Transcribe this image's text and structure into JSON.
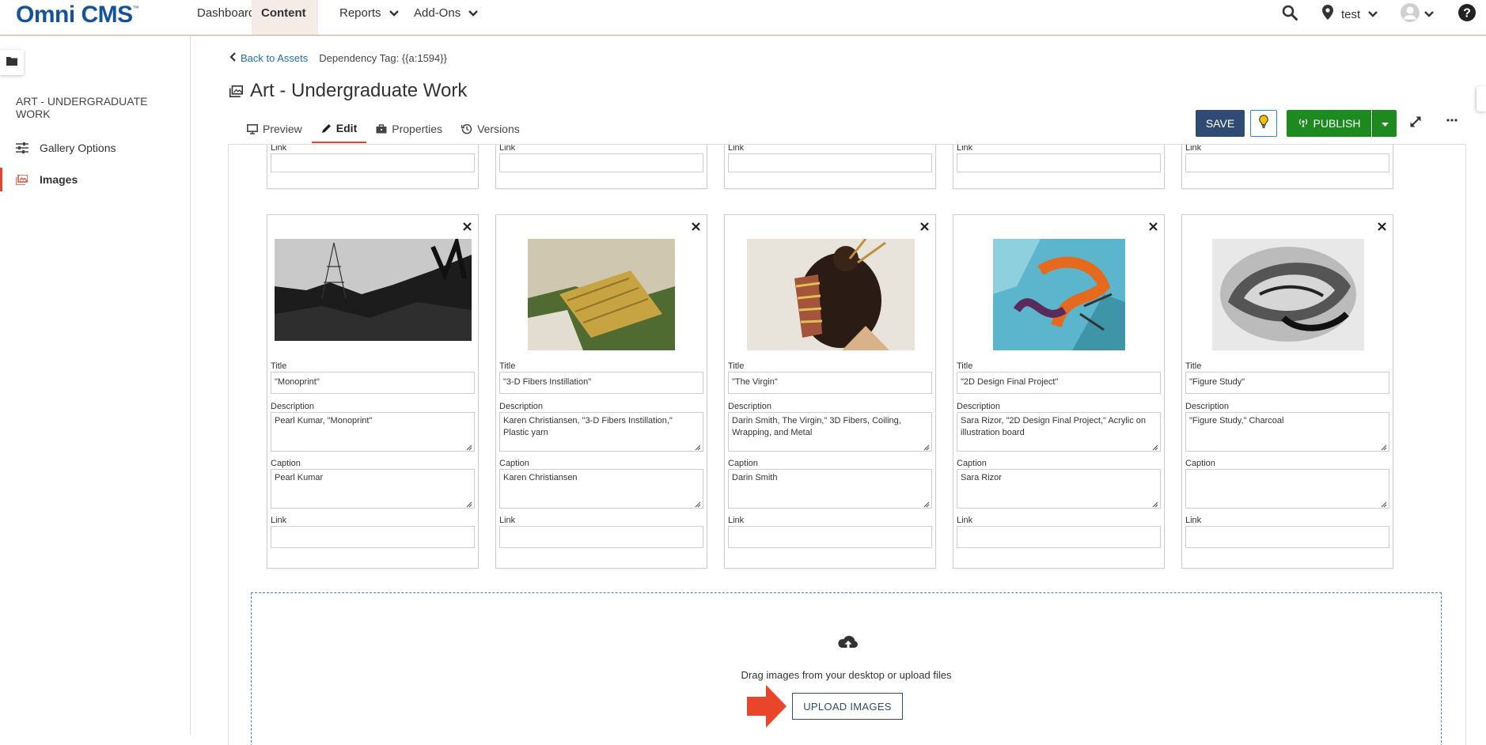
{
  "brand": {
    "logo_text": "Omni CMS",
    "tm": "™"
  },
  "nav": {
    "items": [
      {
        "label": "Dashboard"
      },
      {
        "label": "Content"
      },
      {
        "label": "Reports"
      },
      {
        "label": "Add-Ons"
      }
    ],
    "site_label": "test"
  },
  "sidebar": {
    "title": "ART - UNDERGRADUATE WORK",
    "items": [
      {
        "label": "Gallery Options"
      },
      {
        "label": "Images"
      }
    ]
  },
  "header": {
    "back_link": "Back to Assets",
    "dependency_tag": "Dependency Tag: {{a:1594}}",
    "title": "Art - Undergraduate Work",
    "tabs": [
      {
        "label": "Preview"
      },
      {
        "label": "Edit"
      },
      {
        "label": "Properties"
      },
      {
        "label": "Versions"
      }
    ],
    "save_label": "SAVE",
    "publish_label": "PUBLISH"
  },
  "labels": {
    "title": "Title",
    "description": "Description",
    "caption": "Caption",
    "link": "Link"
  },
  "cards": [
    {
      "title": "\"Monoprint\"",
      "description": "Pearl Kumar, \"Monoprint\"",
      "caption": "Pearl Kumar",
      "link": ""
    },
    {
      "title": "\"3-D Fibers Instillation\"",
      "description": "Karen Christiansen, \"3-D Fibers Instillation,\" Plastic yarn",
      "caption": "Karen Christiansen",
      "link": ""
    },
    {
      "title": "\"The Virgin\"",
      "description": "Darin Smith, The Virgin,\" 3D Fibers, Coiling, Wrapping, and Metal",
      "caption": "Darin Smith",
      "link": ""
    },
    {
      "title": "\"2D Design Final Project\"",
      "description": "Sara Rizor, \"2D Design Final Project,\" Acrylic on illustration board",
      "caption": "Sara Rizor",
      "link": ""
    },
    {
      "title": "\"Figure Study\"",
      "description": "\"Figure Study,\" Charcoal",
      "caption": "",
      "link": ""
    }
  ],
  "upload": {
    "instructions": "Drag images from your desktop or upload files",
    "button_label": "UPLOAD IMAGES"
  },
  "colors": {
    "brand_blue": "#14539a",
    "accent_orange": "#e2452b",
    "save_navy": "#2f4b73",
    "publish_green": "#1d8a1f",
    "link_blue": "#1a6fb5"
  }
}
